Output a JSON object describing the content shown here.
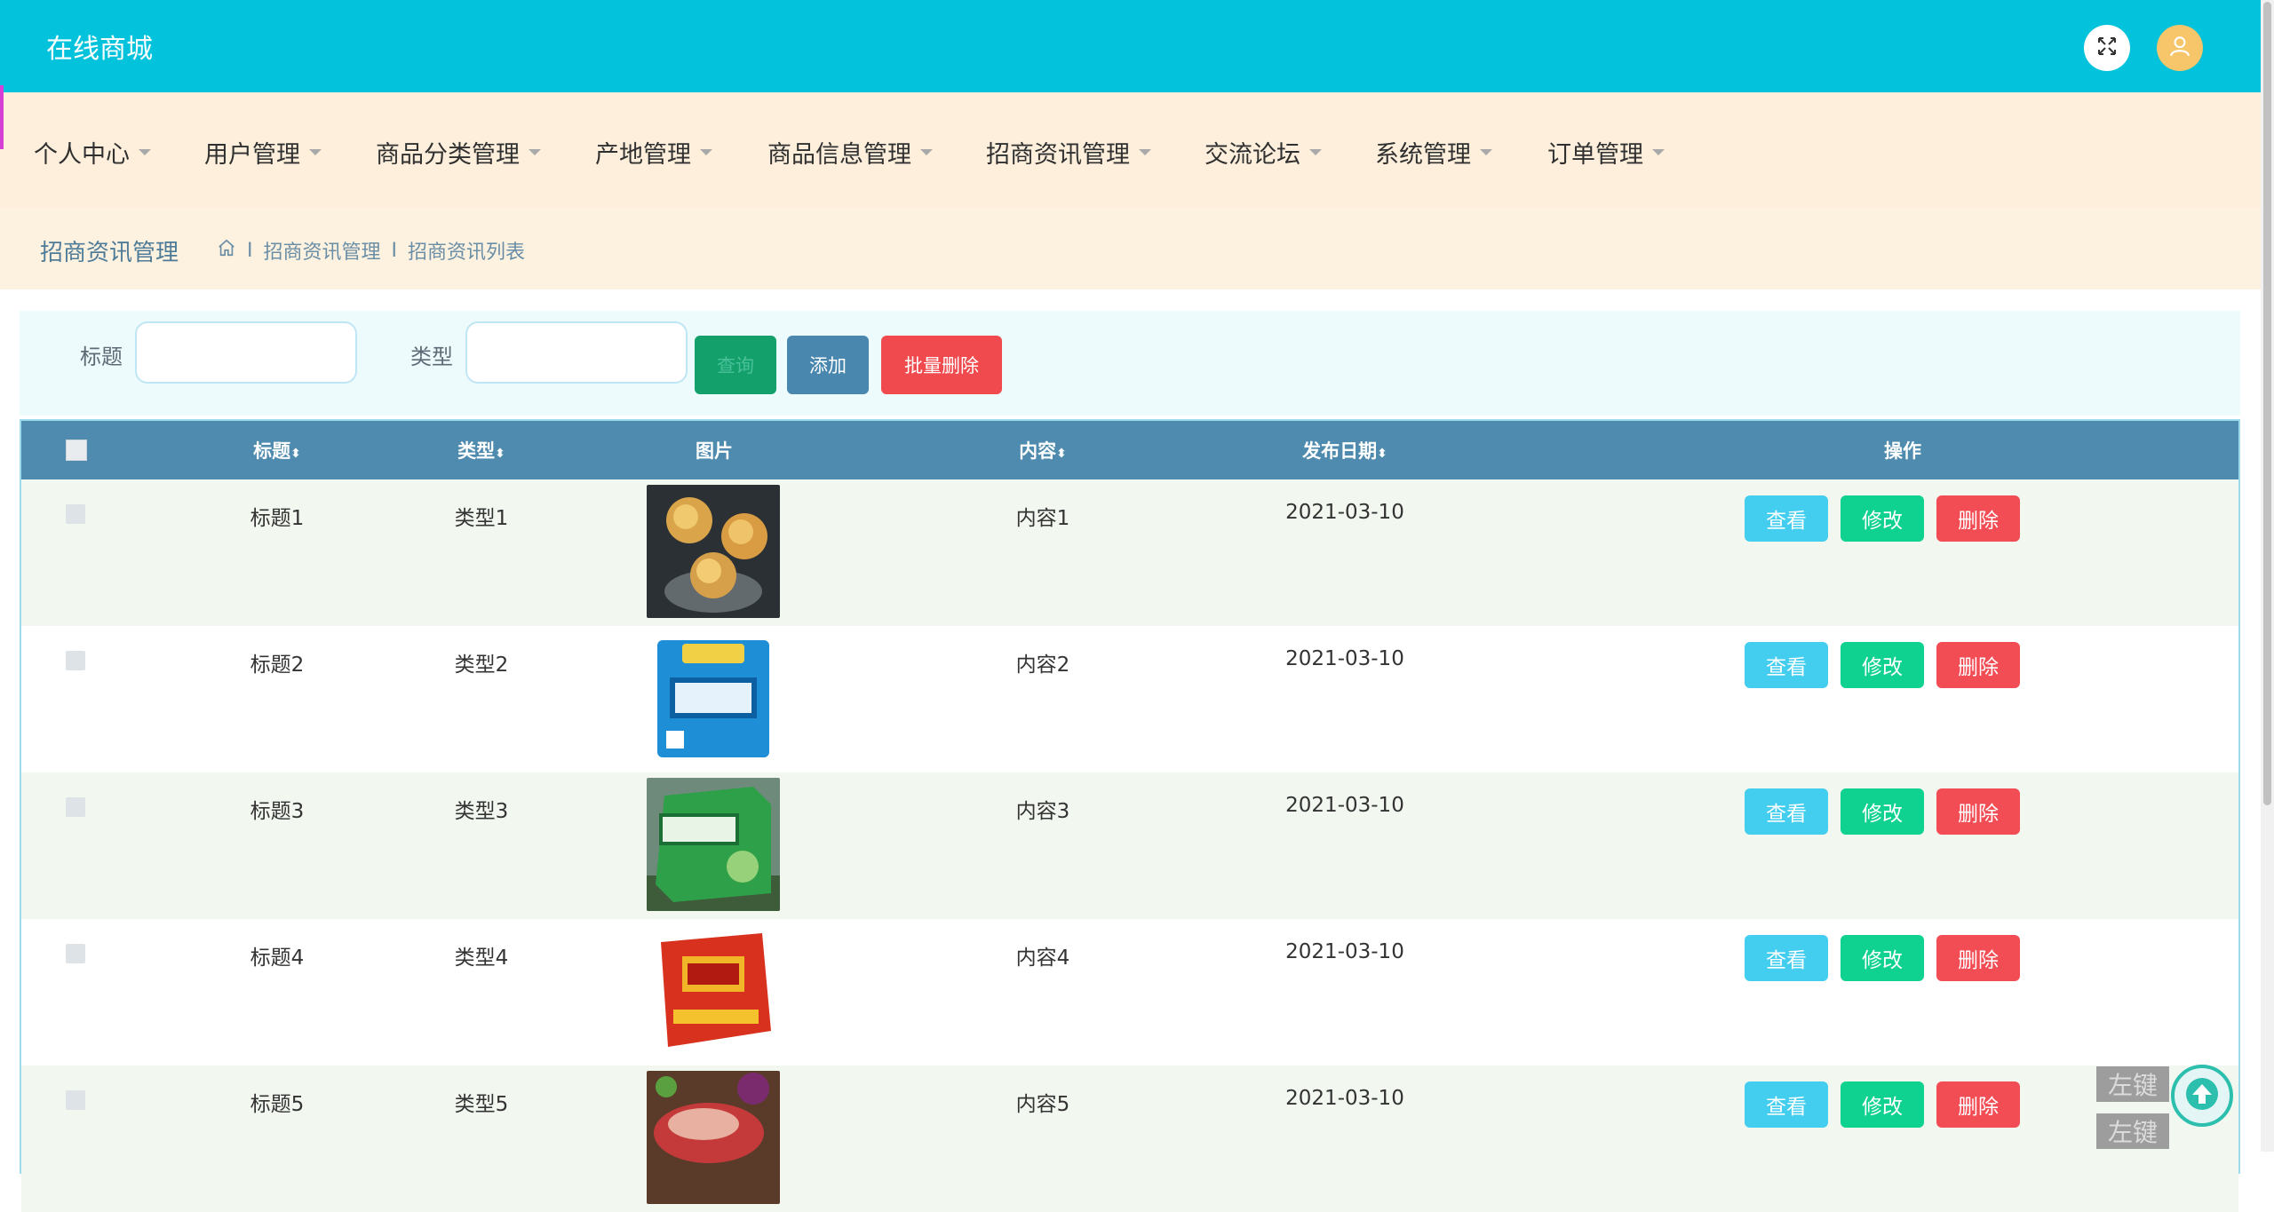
{
  "header": {
    "brand": "在线商城",
    "expand_icon": "expand-icon",
    "user_icon": "user-icon"
  },
  "nav": {
    "items": [
      {
        "label": "个人中心"
      },
      {
        "label": "用户管理"
      },
      {
        "label": "商品分类管理"
      },
      {
        "label": "产地管理"
      },
      {
        "label": "商品信息管理"
      },
      {
        "label": "招商资讯管理"
      },
      {
        "label": "交流论坛"
      },
      {
        "label": "系统管理"
      },
      {
        "label": "订单管理"
      }
    ]
  },
  "breadcrumb": {
    "title": "招商资讯管理",
    "path": [
      "招商资讯管理",
      "招商资讯列表"
    ],
    "sep": "I"
  },
  "search": {
    "title_label": "标题",
    "title_value": "",
    "type_label": "类型",
    "type_value": "",
    "query_label": "查询",
    "add_label": "添加",
    "batch_delete_label": "批量删除"
  },
  "table": {
    "columns": {
      "title": "标题",
      "type": "类型",
      "image": "图片",
      "content": "内容",
      "date": "发布日期",
      "actions": "操作",
      "sort_glyph": "⬍"
    },
    "rows": [
      {
        "title": "标题1",
        "type": "类型1",
        "content": "内容1",
        "date": "2021-03-10"
      },
      {
        "title": "标题2",
        "type": "类型2",
        "content": "内容2",
        "date": "2021-03-10"
      },
      {
        "title": "标题3",
        "type": "类型3",
        "content": "内容3",
        "date": "2021-03-10"
      },
      {
        "title": "标题4",
        "type": "类型4",
        "content": "内容4",
        "date": "2021-03-10"
      },
      {
        "title": "标题5",
        "type": "类型5",
        "content": "内容5",
        "date": "2021-03-10"
      }
    ],
    "actions": {
      "view": "查看",
      "edit": "修改",
      "delete": "删除"
    }
  },
  "floating": {
    "hint1": "左键",
    "hint2": "左键"
  },
  "colors": {
    "header": "#02c2dc",
    "nav": "#fdefdc",
    "table_head": "#4f8bae",
    "view": "#43cdee",
    "edit": "#0fd290",
    "delete": "#f24c54"
  }
}
